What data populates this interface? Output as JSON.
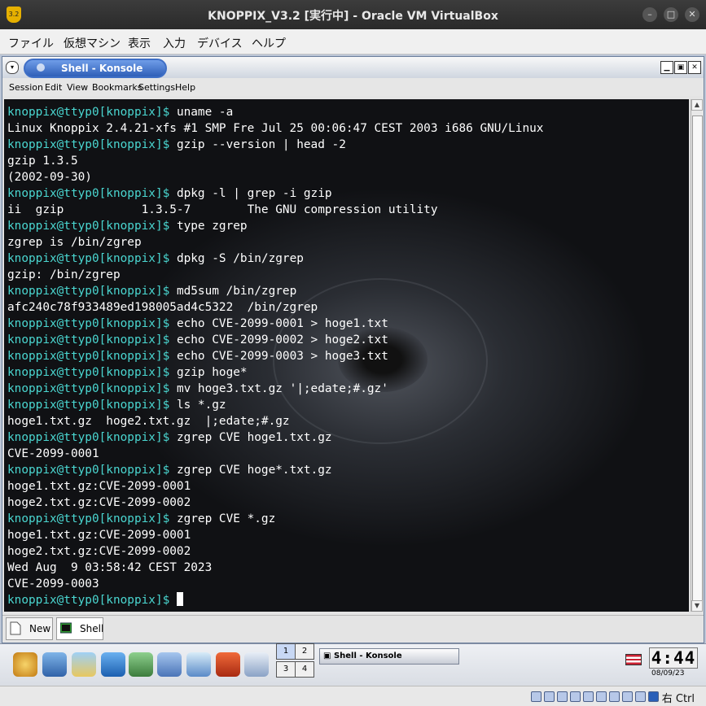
{
  "vbox": {
    "title": "KNOPPIX_V3.2 [実行中] - Oracle VM VirtualBox",
    "menu": [
      "ファイル",
      "仮想マシン",
      "表示",
      "入力",
      "デバイス",
      "ヘルプ"
    ],
    "host_key": "右 Ctrl"
  },
  "konsole": {
    "title": "Shell - Konsole",
    "menu": [
      "Session",
      "Edit",
      "View",
      "Bookmarks",
      "Settings",
      "Help"
    ],
    "tabs": [
      "New",
      "Shell"
    ]
  },
  "terminal": {
    "prompt": "knoppix@ttyp0[knoppix]$",
    "lines": [
      {
        "p": true,
        "t": " uname -a"
      },
      {
        "p": false,
        "t": "Linux Knoppix 2.4.21-xfs #1 SMP Fre Jul 25 00:06:47 CEST 2003 i686 GNU/Linux"
      },
      {
        "p": true,
        "t": " gzip --version | head -2"
      },
      {
        "p": false,
        "t": "gzip 1.3.5"
      },
      {
        "p": false,
        "t": "(2002-09-30)"
      },
      {
        "p": true,
        "t": " dpkg -l | grep -i gzip"
      },
      {
        "p": false,
        "t": "ii  gzip           1.3.5-7        The GNU compression utility"
      },
      {
        "p": true,
        "t": " type zgrep"
      },
      {
        "p": false,
        "t": "zgrep is /bin/zgrep"
      },
      {
        "p": true,
        "t": " dpkg -S /bin/zgrep"
      },
      {
        "p": false,
        "t": "gzip: /bin/zgrep"
      },
      {
        "p": true,
        "t": " md5sum /bin/zgrep"
      },
      {
        "p": false,
        "t": "afc240c78f933489ed198005ad4c5322  /bin/zgrep"
      },
      {
        "p": true,
        "t": " echo CVE-2099-0001 > hoge1.txt"
      },
      {
        "p": true,
        "t": " echo CVE-2099-0002 > hoge2.txt"
      },
      {
        "p": true,
        "t": " echo CVE-2099-0003 > hoge3.txt"
      },
      {
        "p": true,
        "t": " gzip hoge*"
      },
      {
        "p": true,
        "t": " mv hoge3.txt.gz '|;edate;#.gz'"
      },
      {
        "p": true,
        "t": " ls *.gz"
      },
      {
        "p": false,
        "t": "hoge1.txt.gz  hoge2.txt.gz  |;edate;#.gz"
      },
      {
        "p": true,
        "t": " zgrep CVE hoge1.txt.gz"
      },
      {
        "p": false,
        "t": "CVE-2099-0001"
      },
      {
        "p": true,
        "t": " zgrep CVE hoge*.txt.gz"
      },
      {
        "p": false,
        "t": "hoge1.txt.gz:CVE-2099-0001"
      },
      {
        "p": false,
        "t": "hoge2.txt.gz:CVE-2099-0002"
      },
      {
        "p": true,
        "t": " zgrep CVE *.gz"
      },
      {
        "p": false,
        "t": "hoge1.txt.gz:CVE-2099-0001"
      },
      {
        "p": false,
        "t": "hoge2.txt.gz:CVE-2099-0002"
      },
      {
        "p": false,
        "t": "Wed Aug  9 03:58:42 CEST 2023"
      },
      {
        "p": false,
        "t": "CVE-2099-0003"
      },
      {
        "p": true,
        "t": " ",
        "cursor": true
      }
    ]
  },
  "panel": {
    "pager": [
      "1",
      "2",
      "3",
      "4"
    ],
    "task": "Shell - Konsole",
    "clock": "4:44",
    "date": "08/09/23"
  },
  "colors": {
    "prompt": "#4ad6d0",
    "text": "#ffffff"
  }
}
